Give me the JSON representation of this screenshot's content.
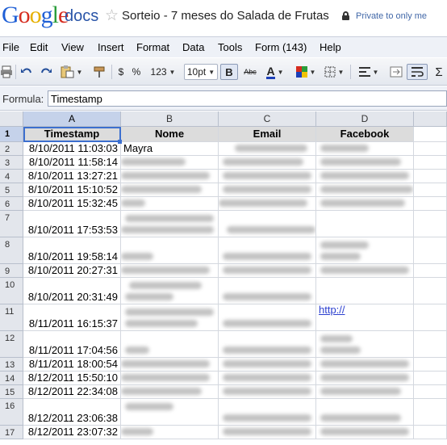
{
  "header": {
    "logo_text": "Google",
    "product": "docs",
    "title": "Sorteio - 7 meses do Salada de Frutas",
    "privacy": "Private to only me"
  },
  "menu": [
    "File",
    "Edit",
    "View",
    "Insert",
    "Format",
    "Data",
    "Tools",
    "Form (143)",
    "Help"
  ],
  "toolbar": {
    "currency": "$",
    "percent": "%",
    "number_format": "123",
    "font_size": "10pt",
    "bold": "B",
    "strike": "Abc",
    "text_color": "A",
    "functions": "Σ"
  },
  "formula_bar": {
    "label": "Formula:",
    "value": "Timestamp"
  },
  "grid": {
    "columns": [
      "A",
      "B",
      "C",
      "D"
    ],
    "headers": [
      "Timestamp",
      "Nome",
      "Email",
      "Facebook"
    ],
    "rows": [
      {
        "num": "1",
        "timestamp": "Timestamp",
        "name": "Nome"
      },
      {
        "num": "2",
        "timestamp": "8/10/2011 11:03:03",
        "name": "Mayra"
      },
      {
        "num": "3",
        "timestamp": "8/10/2011 11:58:14",
        "name": ""
      },
      {
        "num": "4",
        "timestamp": "8/10/2011 13:27:21",
        "name": ""
      },
      {
        "num": "5",
        "timestamp": "8/10/2011 15:10:52",
        "name": ""
      },
      {
        "num": "6",
        "timestamp": "8/10/2011 15:32:45",
        "name": ""
      },
      {
        "num": "7",
        "timestamp": "8/10/2011 17:53:53",
        "name": ""
      },
      {
        "num": "8",
        "timestamp": "8/10/2011 19:58:14",
        "name": ""
      },
      {
        "num": "9",
        "timestamp": "8/10/2011 20:27:31",
        "name": ""
      },
      {
        "num": "10",
        "timestamp": "8/10/2011 20:31:49",
        "name": ""
      },
      {
        "num": "11",
        "timestamp": "8/11/2011 16:15:37",
        "name": "",
        "facebook_link": "http://"
      },
      {
        "num": "12",
        "timestamp": "8/11/2011 17:04:56",
        "name": ""
      },
      {
        "num": "13",
        "timestamp": "8/11/2011 18:00:54",
        "name": ""
      },
      {
        "num": "14",
        "timestamp": "8/12/2011 15:50:10",
        "name": ""
      },
      {
        "num": "15",
        "timestamp": "8/12/2011 22:34:08",
        "name": ""
      },
      {
        "num": "16",
        "timestamp": "8/12/2011 23:06:38",
        "name": ""
      },
      {
        "num": "17",
        "timestamp": "8/12/2011 23:07:32",
        "name": ""
      }
    ]
  },
  "colors": {
    "accent": "#3c6fcf",
    "menu_bg": "#eef1f7",
    "header_cell_bg": "#dcdcdc",
    "link": "#2b3fcf"
  }
}
